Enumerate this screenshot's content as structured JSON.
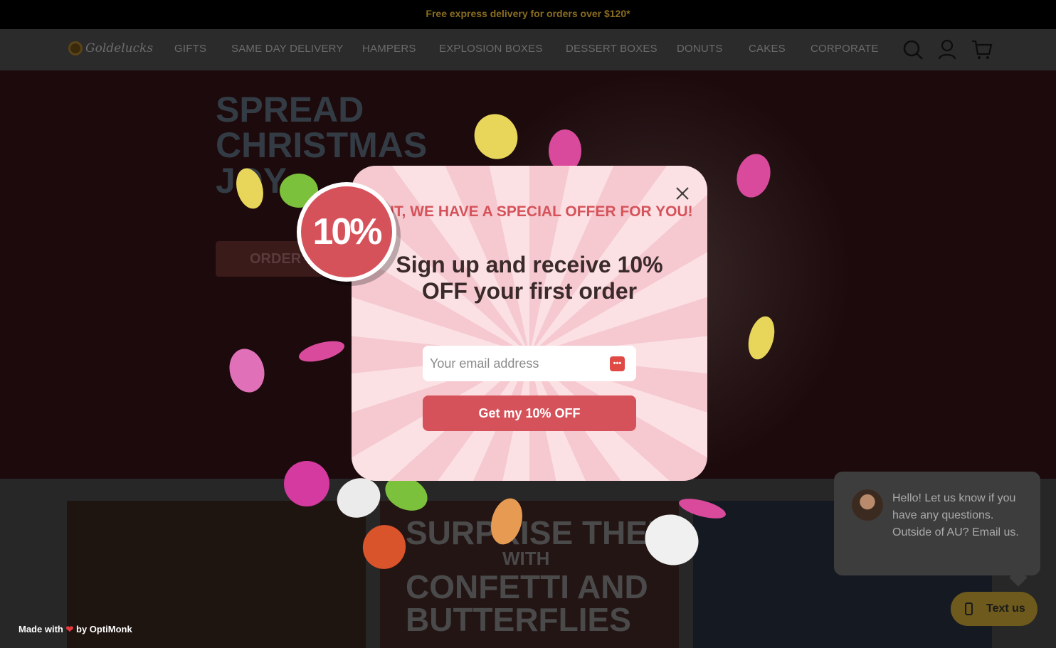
{
  "top_banner": {
    "text": "Free express delivery for orders over $120*"
  },
  "header": {
    "logo_text": "Goldelucks",
    "nav": [
      "GIFTS",
      "SAME DAY DELIVERY",
      "HAMPERS",
      "EXPLOSION BOXES",
      "DESSERT BOXES",
      "DONUTS",
      "CAKES",
      "CORPORATE"
    ],
    "icons": [
      "search-icon",
      "account-icon",
      "cart-icon"
    ]
  },
  "hero": {
    "title": "SPREAD CHRISTMAS JOY",
    "button_label": "ORDER"
  },
  "cards": {
    "card2_line1": "SURPRISE THEM",
    "card2_with": "WITH",
    "card2_line2": "CONFETTI AND BUTTERFLIES"
  },
  "popup": {
    "badge": "10%",
    "eyebrow": "WAIT, WE HAVE A SPECIAL OFFER FOR YOU!",
    "headline": "Sign up and receive 10% OFF your first order",
    "email_placeholder": "Your email address",
    "cta_label": "Get my 10% OFF",
    "close_icon": "close-icon"
  },
  "footer_badge": {
    "made_with": "Made with",
    "by": "by OptiMonk",
    "heart_color": "#e5393e"
  },
  "chat": {
    "message": "Hello! Let us know if you have any questions. Outside of AU? Email us.",
    "button_label": "Text us"
  },
  "colors": {
    "accent": "#d6525a",
    "popup_pink": "#f5c9cf",
    "headline_dark": "#3a2a2a"
  }
}
